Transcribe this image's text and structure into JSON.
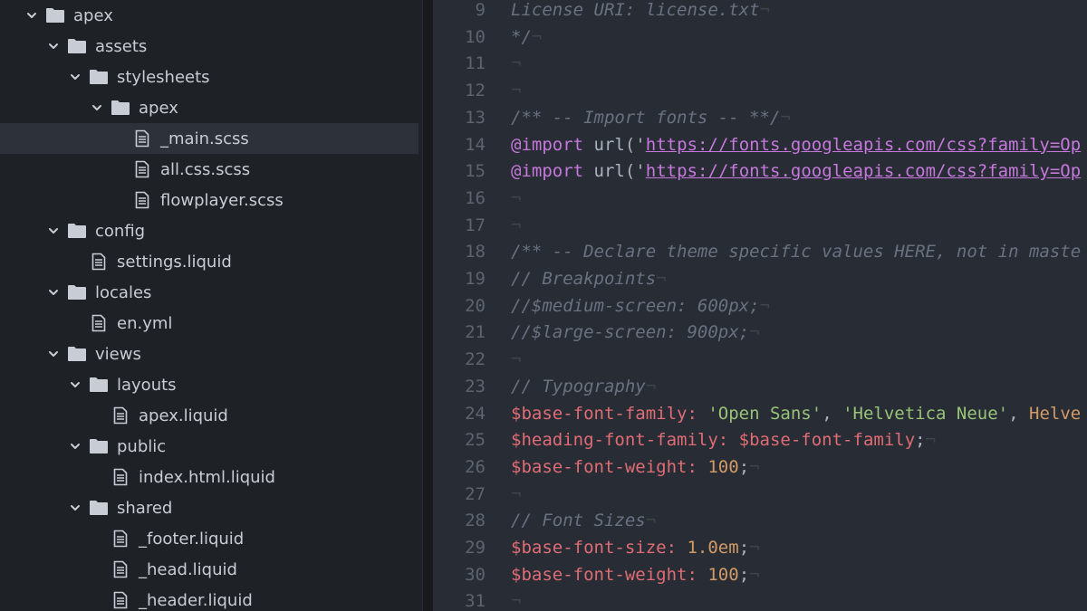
{
  "tree": [
    {
      "label": "apex",
      "type": "folder",
      "expanded": true,
      "depth": 0
    },
    {
      "label": "assets",
      "type": "folder",
      "expanded": true,
      "depth": 1
    },
    {
      "label": "stylesheets",
      "type": "folder",
      "expanded": true,
      "depth": 2
    },
    {
      "label": "apex",
      "type": "folder",
      "expanded": true,
      "depth": 3
    },
    {
      "label": "_main.scss",
      "type": "file",
      "depth": 4,
      "selected": true
    },
    {
      "label": "all.css.scss",
      "type": "file",
      "depth": 4
    },
    {
      "label": "flowplayer.scss",
      "type": "file",
      "depth": 4
    },
    {
      "label": "config",
      "type": "folder",
      "expanded": true,
      "depth": 1
    },
    {
      "label": "settings.liquid",
      "type": "file",
      "depth": 2
    },
    {
      "label": "locales",
      "type": "folder",
      "expanded": true,
      "depth": 1
    },
    {
      "label": "en.yml",
      "type": "file",
      "depth": 2
    },
    {
      "label": "views",
      "type": "folder",
      "expanded": true,
      "depth": 1
    },
    {
      "label": "layouts",
      "type": "folder",
      "expanded": true,
      "depth": 2
    },
    {
      "label": "apex.liquid",
      "type": "file",
      "depth": 3
    },
    {
      "label": "public",
      "type": "folder",
      "expanded": true,
      "depth": 2
    },
    {
      "label": "index.html.liquid",
      "type": "file",
      "depth": 3
    },
    {
      "label": "shared",
      "type": "folder",
      "expanded": true,
      "depth": 2
    },
    {
      "label": "_footer.liquid",
      "type": "file",
      "depth": 3
    },
    {
      "label": "_head.liquid",
      "type": "file",
      "depth": 3
    },
    {
      "label": "_header.liquid",
      "type": "file",
      "depth": 3
    }
  ],
  "code": [
    {
      "n": "9",
      "tokens": [
        {
          "t": "License URI: license.txt",
          "c": "cmt"
        },
        {
          "t": "¬",
          "c": "invis"
        }
      ]
    },
    {
      "n": "10",
      "tokens": [
        {
          "t": "*/",
          "c": "cmt"
        },
        {
          "t": "¬",
          "c": "invis"
        }
      ]
    },
    {
      "n": "11",
      "tokens": [
        {
          "t": "¬",
          "c": "invis"
        }
      ]
    },
    {
      "n": "12",
      "tokens": [
        {
          "t": "¬",
          "c": "invis"
        }
      ]
    },
    {
      "n": "13",
      "tokens": [
        {
          "t": "/** -- Import fonts -- **/",
          "c": "cmt"
        },
        {
          "t": "¬",
          "c": "invis"
        }
      ]
    },
    {
      "n": "14",
      "tokens": [
        {
          "t": "@import",
          "c": "kw"
        },
        {
          "t": " ",
          "c": "punc"
        },
        {
          "t": "url",
          "c": "fnu"
        },
        {
          "t": "('",
          "c": "punc"
        },
        {
          "t": "https://fonts.googleapis.com/css?family=Op",
          "c": "url"
        }
      ]
    },
    {
      "n": "15",
      "tokens": [
        {
          "t": "@import",
          "c": "kw"
        },
        {
          "t": " ",
          "c": "punc"
        },
        {
          "t": "url",
          "c": "fnu"
        },
        {
          "t": "('",
          "c": "punc"
        },
        {
          "t": "https://fonts.googleapis.com/css?family=Op",
          "c": "url"
        }
      ]
    },
    {
      "n": "16",
      "tokens": [
        {
          "t": "¬",
          "c": "invis"
        }
      ]
    },
    {
      "n": "17",
      "tokens": [
        {
          "t": "¬",
          "c": "invis"
        }
      ]
    },
    {
      "n": "18",
      "tokens": [
        {
          "t": "/** -- Declare theme specific values HERE, not in maste",
          "c": "cmt"
        }
      ]
    },
    {
      "n": "19",
      "tokens": [
        {
          "t": "// Breakpoints",
          "c": "cmt"
        },
        {
          "t": "¬",
          "c": "invis"
        }
      ]
    },
    {
      "n": "20",
      "tokens": [
        {
          "t": "//$medium-screen: 600px;",
          "c": "cmt"
        },
        {
          "t": "¬",
          "c": "invis"
        }
      ]
    },
    {
      "n": "21",
      "tokens": [
        {
          "t": "//$large-screen: 900px;",
          "c": "cmt"
        },
        {
          "t": "¬",
          "c": "invis"
        }
      ]
    },
    {
      "n": "22",
      "tokens": [
        {
          "t": "¬",
          "c": "invis"
        }
      ]
    },
    {
      "n": "23",
      "tokens": [
        {
          "t": "// Typography",
          "c": "cmt"
        },
        {
          "t": "¬",
          "c": "invis"
        }
      ]
    },
    {
      "n": "24",
      "tokens": [
        {
          "t": "$base-font-family:",
          "c": "var"
        },
        {
          "t": " ",
          "c": "punc"
        },
        {
          "t": "'Open Sans'",
          "c": "str"
        },
        {
          "t": ", ",
          "c": "punc"
        },
        {
          "t": "'Helvetica Neue'",
          "c": "str"
        },
        {
          "t": ", ",
          "c": "punc"
        },
        {
          "t": "Helve",
          "c": "num"
        }
      ]
    },
    {
      "n": "25",
      "tokens": [
        {
          "t": "$heading-font-family:",
          "c": "var"
        },
        {
          "t": " ",
          "c": "punc"
        },
        {
          "t": "$base-font-family",
          "c": "var"
        },
        {
          "t": ";",
          "c": "punc"
        },
        {
          "t": "¬",
          "c": "invis"
        }
      ]
    },
    {
      "n": "26",
      "tokens": [
        {
          "t": "$base-font-weight:",
          "c": "var"
        },
        {
          "t": " ",
          "c": "punc"
        },
        {
          "t": "100",
          "c": "num"
        },
        {
          "t": ";",
          "c": "punc"
        },
        {
          "t": "¬",
          "c": "invis"
        }
      ]
    },
    {
      "n": "27",
      "tokens": [
        {
          "t": "¬",
          "c": "invis"
        }
      ]
    },
    {
      "n": "28",
      "tokens": [
        {
          "t": "// Font Sizes",
          "c": "cmt"
        },
        {
          "t": "¬",
          "c": "invis"
        }
      ]
    },
    {
      "n": "29",
      "tokens": [
        {
          "t": "$base-font-size:",
          "c": "var"
        },
        {
          "t": " ",
          "c": "punc"
        },
        {
          "t": "1.0em",
          "c": "num"
        },
        {
          "t": ";",
          "c": "punc"
        },
        {
          "t": "¬",
          "c": "invis"
        }
      ]
    },
    {
      "n": "30",
      "tokens": [
        {
          "t": "$base-font-weight:",
          "c": "var"
        },
        {
          "t": " ",
          "c": "punc"
        },
        {
          "t": "100",
          "c": "num"
        },
        {
          "t": ";",
          "c": "punc"
        },
        {
          "t": "¬",
          "c": "invis"
        }
      ]
    },
    {
      "n": "31",
      "tokens": [
        {
          "t": "¬",
          "c": "invis"
        }
      ]
    }
  ],
  "icons": {
    "folder": "folder-icon",
    "file": "file-icon",
    "chevron": "chevron-down-icon"
  },
  "colors": {
    "sidebar_bg": "#1e2126",
    "editor_bg": "#282c34",
    "selected_row": "#2c313a",
    "comment": "#6a7180",
    "keyword": "#c678dd",
    "variable": "#e06c75",
    "string": "#98c379",
    "number": "#d19a66"
  }
}
